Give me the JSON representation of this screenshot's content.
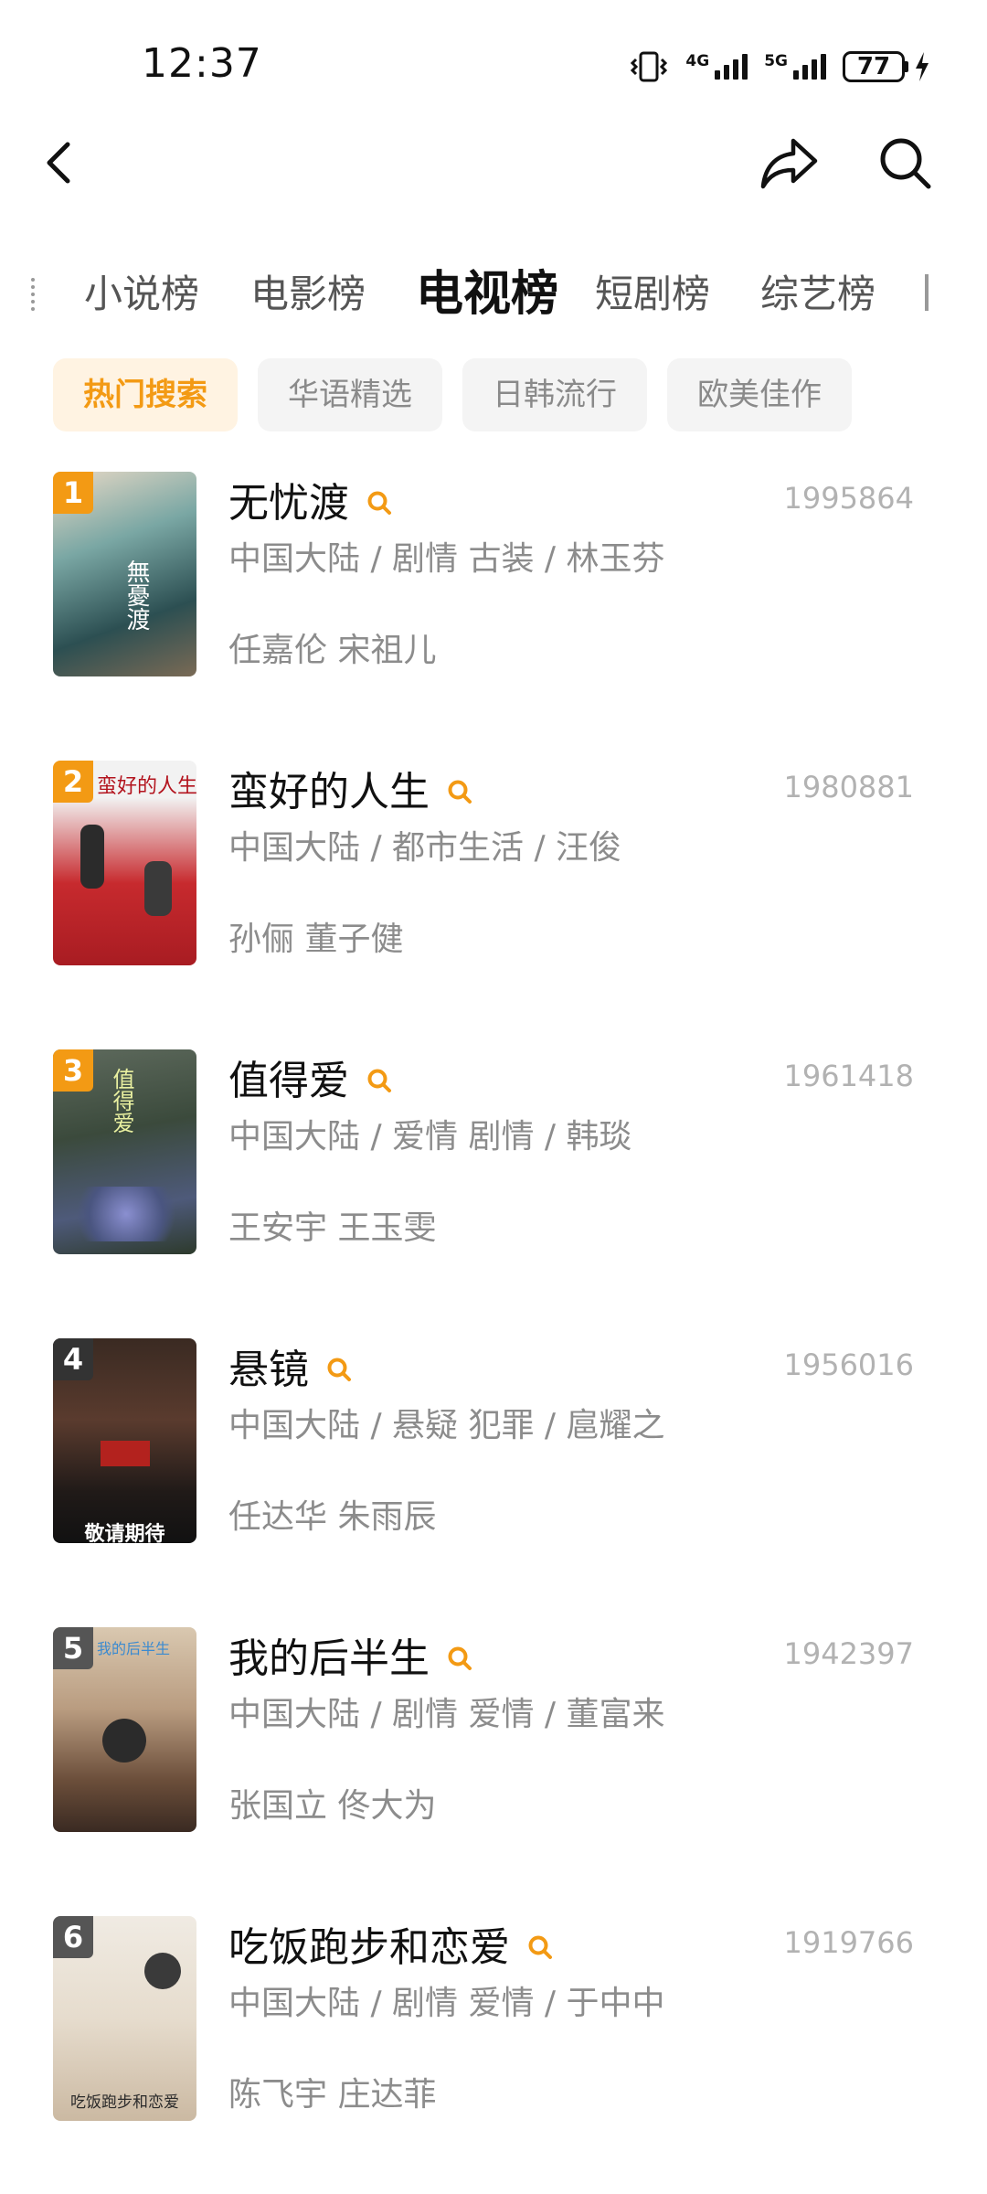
{
  "status_bar": {
    "time": "12:37",
    "network1": "4G",
    "network2": "5G",
    "battery": "77"
  },
  "nav": {
    "back_icon": "back-arrow-icon",
    "share_icon": "share-icon",
    "search_icon": "search-icon"
  },
  "category_tabs": [
    {
      "label": "小说榜"
    },
    {
      "label": "电影榜"
    },
    {
      "label": "电视榜",
      "active": true
    },
    {
      "label": "短剧榜"
    },
    {
      "label": "综艺榜"
    }
  ],
  "filter_chips": [
    {
      "label": "热门搜索",
      "active": true
    },
    {
      "label": "华语精选"
    },
    {
      "label": "日韩流行"
    },
    {
      "label": "欧美佳作"
    }
  ],
  "accent_color": "#f39a14",
  "items": [
    {
      "rank": "1",
      "title": "无忧渡",
      "meta": "中国大陆 / 剧情 古装 / 林玉芬",
      "actors": "任嘉伦 宋祖儿",
      "count": "1995864",
      "poster_caption": "無憂渡"
    },
    {
      "rank": "2",
      "title": "蛮好的人生",
      "meta": "中国大陆 / 都市生活 / 汪俊",
      "actors": "孙俪 董子健",
      "count": "1980881",
      "poster_caption": "蛮好的人生"
    },
    {
      "rank": "3",
      "title": "值得爱",
      "meta": "中国大陆 / 爱情 剧情 / 韩琰",
      "actors": "王安宇 王玉雯",
      "count": "1961418",
      "poster_caption": "值得爱"
    },
    {
      "rank": "4",
      "title": "悬镜",
      "meta": "中国大陆 / 悬疑 犯罪 / 扈耀之",
      "actors": "任达华 朱雨辰",
      "count": "1956016",
      "poster_caption": "敬请期待"
    },
    {
      "rank": "5",
      "title": "我的后半生",
      "meta": "中国大陆 / 剧情 爱情 / 董富来",
      "actors": "张国立 佟大为",
      "count": "1942397",
      "poster_caption": "我的后半生"
    },
    {
      "rank": "6",
      "title": "吃饭跑步和恋爱",
      "meta": "中国大陆 / 剧情 爱情 / 于中中",
      "actors": "陈飞宇 庄达菲",
      "count": "1919766",
      "poster_caption": "吃饭跑步和恋爱"
    }
  ]
}
